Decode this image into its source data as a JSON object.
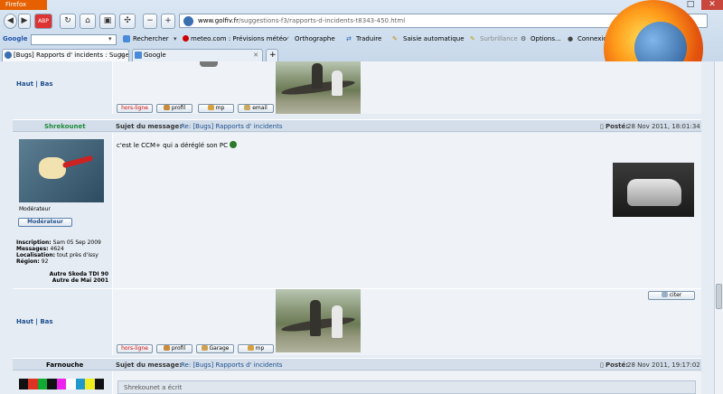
{
  "browser": {
    "app_button": "Firefox",
    "url_domain": "www.golfiv.fr",
    "url_path": "/suggestions-f3/rapports-d-incidents-t8343-450.html",
    "google_label": "Google",
    "search_btn": "Rechercher",
    "toolbar_items": [
      "meteo.com : Prévisions météo",
      "Orthographe",
      "Traduire",
      "Saisie automatique",
      "Surbrillance",
      "Options...",
      "Connexion"
    ],
    "tabs": [
      "[Bugs] Rapports d' incidents : Sugges...",
      "Google"
    ],
    "new_tab": "+"
  },
  "post_top": {
    "links": "Haut | Bas",
    "buttons": [
      "hors-ligne",
      "profil",
      "mp",
      "email"
    ]
  },
  "post_shrekounet": {
    "author": "Shrekounet",
    "subject_label": "Sujet du message:",
    "subject": "Re: [Bugs] Rapports d' incidents",
    "posted_label": "Posté:",
    "posted": "28 Nov 2011, 18:01:34",
    "body": "c'est le CCM+ qui a déréglé son PC",
    "rank": "Modérateur",
    "rank_badge": "Modérateur",
    "info": [
      {
        "label": "Inscription:",
        "value": "Sam 05 Sep 2009"
      },
      {
        "label": "Messages:",
        "value": "4624"
      },
      {
        "label": "Localisation:",
        "value": "tout près d'issy"
      },
      {
        "label": "Région:",
        "value": "92"
      }
    ],
    "cars": [
      "Autre Skoda TDI 90",
      "Autre de Mai 2001"
    ],
    "links": "Haut | Bas",
    "quote_btn": "citer",
    "buttons": [
      "hors-ligne",
      "profil",
      "Garage",
      "mp"
    ]
  },
  "post_farnouche": {
    "author": "Farnouche",
    "subject_label": "Sujet du message:",
    "subject": "Re: [Bugs] Rapports d' incidents",
    "posted_label": "Posté:",
    "posted": "28 Nov 2011, 19:17:02",
    "quote_text": "Shrekounet a écrit"
  }
}
